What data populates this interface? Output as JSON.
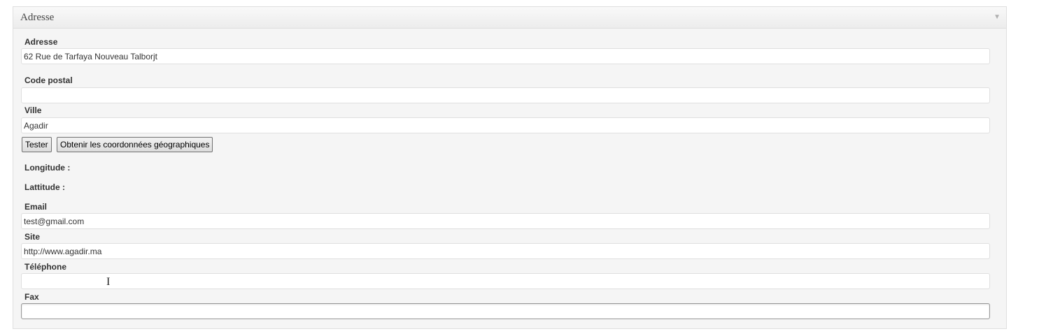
{
  "panel": {
    "title": "Adresse",
    "toggle_icon": "▼"
  },
  "fields": {
    "adresse": {
      "label": "Adresse",
      "value": "62 Rue de Tarfaya Nouveau Talborjt"
    },
    "code_postal": {
      "label": "Code postal",
      "value": ""
    },
    "ville": {
      "label": "Ville",
      "value": "Agadir"
    },
    "longitude": {
      "label": "Longitude :"
    },
    "lattitude": {
      "label": "Lattitude :"
    },
    "email": {
      "label": "Email",
      "value": "test@gmail.com"
    },
    "site": {
      "label": "Site",
      "value": "http://www.agadir.ma"
    },
    "telephone": {
      "label": "Téléphone",
      "value": ""
    },
    "fax": {
      "label": "Fax",
      "value": ""
    }
  },
  "buttons": {
    "tester": "Tester",
    "geocode": "Obtenir les coordonnées géographiques"
  },
  "icons": {
    "toggle": "triangle-down-icon",
    "cursor": "text-cursor-icon"
  }
}
